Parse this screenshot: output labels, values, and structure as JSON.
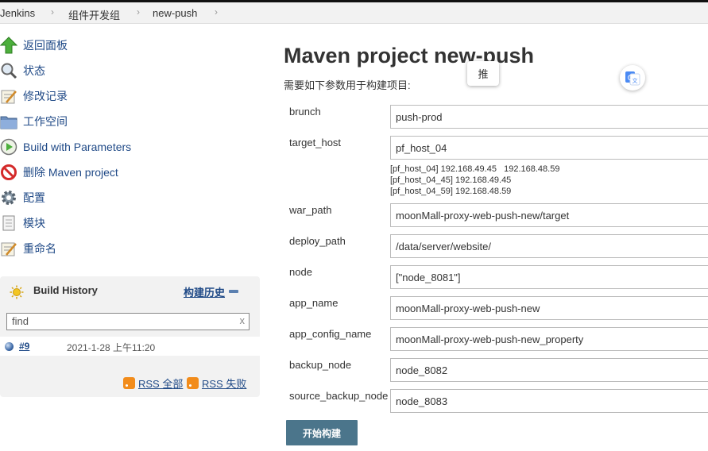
{
  "breadcrumb": [
    "Jenkins",
    "组件开发组",
    "new-push"
  ],
  "sidebar": {
    "tasks": [
      {
        "label": "返回面板",
        "icon": "up-arrow-icon"
      },
      {
        "label": "状态",
        "icon": "search-icon"
      },
      {
        "label": "修改记录",
        "icon": "notepad-icon"
      },
      {
        "label": "工作空间",
        "icon": "folder-icon"
      },
      {
        "label": "Build with Parameters",
        "icon": "clock-icon"
      },
      {
        "label": "删除 Maven project",
        "icon": "no-entry-icon"
      },
      {
        "label": "配置",
        "icon": "gear-icon"
      },
      {
        "label": "模块",
        "icon": "document-icon"
      },
      {
        "label": "重命名",
        "icon": "notepad-icon"
      }
    ]
  },
  "build_history": {
    "title": "Build History",
    "trend_label": "构建历史",
    "search_placeholder": "find",
    "clear": "x",
    "builds": [
      {
        "number": "#9",
        "date": "2021-1-28 上午11:20"
      }
    ],
    "rss_all": "RSS 全部",
    "rss_failed": "RSS 失败"
  },
  "main": {
    "title": "Maven project new-push",
    "description": "需要如下参数用于构建项目:",
    "params": [
      {
        "name": "brunch",
        "value": "push-prod"
      },
      {
        "name": "target_host",
        "value": "pf_host_04",
        "help": [
          "[pf_host_04] 192.168.49.45   192.168.48.59",
          "[pf_host_04_45] 192.168.49.45",
          "[pf_host_04_59] 192.168.48.59"
        ]
      },
      {
        "name": "war_path",
        "value": "moonMall-proxy-web-push-new/target"
      },
      {
        "name": "deploy_path",
        "value": "/data/server/website/"
      },
      {
        "name": "node",
        "value": "[\"node_8081\"]"
      },
      {
        "name": "app_name",
        "value": "moonMall-proxy-web-push-new"
      },
      {
        "name": "app_config_name",
        "value": "moonMall-proxy-web-push-new_property"
      },
      {
        "name": "backup_node",
        "value": "node_8082"
      },
      {
        "name": "source_backup_node",
        "value": "node_8083"
      }
    ],
    "build_button": "开始构建"
  },
  "overlay": {
    "tooltip": "推",
    "translate_icon": "translate-icon"
  }
}
